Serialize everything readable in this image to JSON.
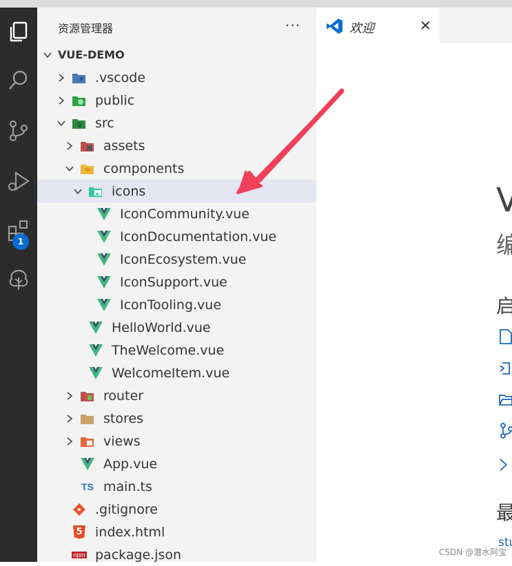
{
  "explorer": {
    "title": "资源管理器",
    "more": "···",
    "root": "VUE-DEMO",
    "items": [
      {
        "label": ".vscode",
        "icon": "vscode-folder-icon",
        "chev": "right"
      },
      {
        "label": "public",
        "icon": "public-folder-icon",
        "chev": "right"
      },
      {
        "label": "src",
        "icon": "src-folder-icon",
        "chev": "down"
      },
      {
        "label": "assets",
        "icon": "assets-folder-icon",
        "chev": "right"
      },
      {
        "label": "components",
        "icon": "components-folder-icon",
        "chev": "down"
      },
      {
        "label": "icons",
        "icon": "images-folder-icon",
        "chev": "down"
      },
      {
        "label": "IconCommunity.vue",
        "icon": "vue-file-icon"
      },
      {
        "label": "IconDocumentation.vue",
        "icon": "vue-file-icon"
      },
      {
        "label": "IconEcosystem.vue",
        "icon": "vue-file-icon"
      },
      {
        "label": "IconSupport.vue",
        "icon": "vue-file-icon"
      },
      {
        "label": "IconTooling.vue",
        "icon": "vue-file-icon"
      },
      {
        "label": "HelloWorld.vue",
        "icon": "vue-file-icon"
      },
      {
        "label": "TheWelcome.vue",
        "icon": "vue-file-icon"
      },
      {
        "label": "WelcomeItem.vue",
        "icon": "vue-file-icon"
      },
      {
        "label": "router",
        "icon": "router-folder-icon",
        "chev": "right"
      },
      {
        "label": "stores",
        "icon": "folder-icon",
        "chev": "right"
      },
      {
        "label": "views",
        "icon": "views-folder-icon",
        "chev": "right"
      },
      {
        "label": "App.vue",
        "icon": "vue-file-icon"
      },
      {
        "label": "main.ts",
        "icon": "typescript-file-icon",
        "icon_text": "TS"
      },
      {
        "label": ".gitignore",
        "icon": "git-file-icon"
      },
      {
        "label": "index.html",
        "icon": "html5-file-icon",
        "icon_text": "5"
      },
      {
        "label": "package.json",
        "icon": "npm-file-icon",
        "icon_text": "npm"
      }
    ]
  },
  "activity": {
    "extensions_badge": "1"
  },
  "editor": {
    "tab_label": "欢迎",
    "tab_close": "✕",
    "welcome_big": "V",
    "welcome_sub": "编",
    "welcome_start": "启",
    "welcome_recent": "最",
    "welcome_link": "stu"
  },
  "watermark": "CSDN @潜水阿宝",
  "colors": {
    "activity_bar": "#2c2c2c",
    "sidebar": "#f3f3f3",
    "selection": "#e4e6f1",
    "vue_green": "#41b883",
    "vue_dark": "#35495e",
    "arrow": "#f0405a",
    "vscode_blue": "#0a6cd1"
  }
}
